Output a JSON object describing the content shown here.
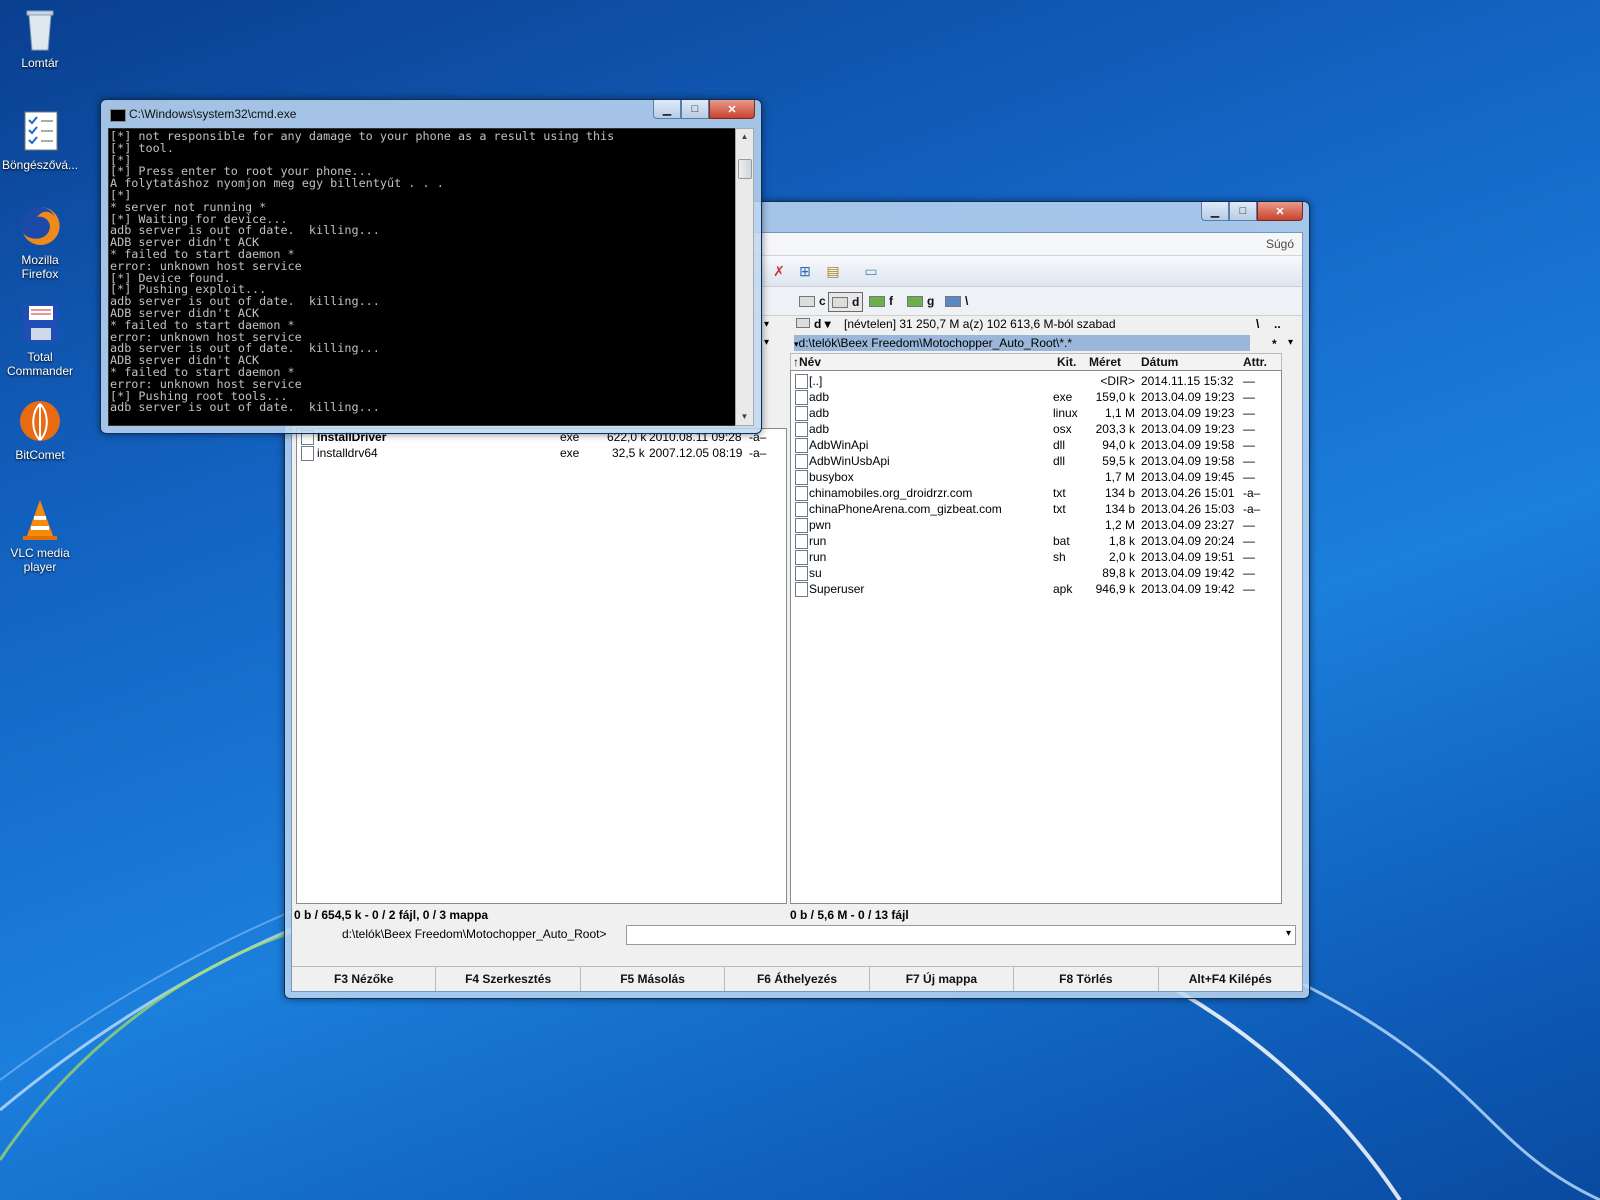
{
  "desktop": {
    "icons": [
      {
        "label": "Lomtár",
        "icon": "recycle-bin-icon"
      },
      {
        "label": "Böngészővá...",
        "icon": "checklist-icon"
      },
      {
        "label": "Mozilla Firefox",
        "icon": "firefox-icon"
      },
      {
        "label": "Total Commander",
        "icon": "floppy-disk-icon"
      },
      {
        "label": "BitComet",
        "icon": "bitcomet-icon"
      },
      {
        "label": "VLC media player",
        "icon": "vlc-cone-icon"
      }
    ]
  },
  "cmd": {
    "title": "C:\\Windows\\system32\\cmd.exe",
    "output": "[*] not responsible for any damage to your phone as a result using this\n[*] tool.\n[*]\n[*] Press enter to root your phone...\nA folytatáshoz nyomjon meg egy billentyűt . . .\n[*]\n* server not running *\n[*] Waiting for device...\nadb server is out of date.  killing...\nADB server didn't ACK\n* failed to start daemon *\nerror: unknown host service\n[*] Device found.\n[*] Pushing exploit...\nadb server is out of date.  killing...\nADB server didn't ACK\n* failed to start daemon *\nerror: unknown host service\nadb server is out of date.  killing...\nADB server didn't ACK\n* failed to start daemon *\nerror: unknown host service\n[*] Pushing root tools...\nadb server is out of date.  killing..."
  },
  "tc": {
    "menu_help": "Súgó",
    "drives": [
      {
        "label": "c",
        "selected": false
      },
      {
        "label": "d",
        "selected": true
      },
      {
        "label": "f",
        "selected": false
      },
      {
        "label": "g",
        "selected": false
      },
      {
        "label": "\\",
        "selected": false
      }
    ],
    "right": {
      "drive_combo": "d",
      "free_space": "[névtelen]  31 250,7 M a(z) 102 613,6 M-ból szabad",
      "root_btn": "\\",
      "up_btn": "..",
      "path": "d:\\telók\\Beex Freedom\\Motochopper_Auto_Root\\*.*",
      "filter": "*",
      "columns": {
        "name": "Név",
        "ext": "Kit.",
        "size": "Méret",
        "date": "Dátum",
        "attr": "Attr."
      },
      "files": [
        {
          "name": "[..]",
          "ext": "",
          "size": "<DIR>",
          "date": "2014.11.15 15:32",
          "attr": "—"
        },
        {
          "name": "adb",
          "ext": "exe",
          "size": "159,0 k",
          "date": "2013.04.09 19:23",
          "attr": "—"
        },
        {
          "name": "adb",
          "ext": "linux",
          "size": "1,1 M",
          "date": "2013.04.09 19:23",
          "attr": "—"
        },
        {
          "name": "adb",
          "ext": "osx",
          "size": "203,3 k",
          "date": "2013.04.09 19:23",
          "attr": "—"
        },
        {
          "name": "AdbWinApi",
          "ext": "dll",
          "size": "94,0 k",
          "date": "2013.04.09 19:58",
          "attr": "—"
        },
        {
          "name": "AdbWinUsbApi",
          "ext": "dll",
          "size": "59,5 k",
          "date": "2013.04.09 19:58",
          "attr": "—"
        },
        {
          "name": "busybox",
          "ext": "",
          "size": "1,7 M",
          "date": "2013.04.09 19:45",
          "attr": "—"
        },
        {
          "name": "chinamobiles.org_droidrzr.com",
          "ext": "txt",
          "size": "134 b",
          "date": "2013.04.26 15:01",
          "attr": "-a–"
        },
        {
          "name": "chinaPhoneArena.com_gizbeat.com",
          "ext": "txt",
          "size": "134 b",
          "date": "2013.04.26 15:03",
          "attr": "-a–"
        },
        {
          "name": "pwn",
          "ext": "",
          "size": "1,2 M",
          "date": "2013.04.09 23:27",
          "attr": "—"
        },
        {
          "name": "run",
          "ext": "bat",
          "size": "1,8 k",
          "date": "2013.04.09 20:24",
          "attr": "—"
        },
        {
          "name": "run",
          "ext": "sh",
          "size": "2,0 k",
          "date": "2013.04.09 19:51",
          "attr": "—"
        },
        {
          "name": "su",
          "ext": "",
          "size": "89,8 k",
          "date": "2013.04.09 19:42",
          "attr": "—"
        },
        {
          "name": "Superuser",
          "ext": "apk",
          "size": "946,9 k",
          "date": "2013.04.09 19:42",
          "attr": "—"
        }
      ],
      "status": "0 b / 5,6 M - 0 / 13 fájl"
    },
    "left": {
      "files": [
        {
          "name": "InstallDriver",
          "ext": "exe",
          "size": "622,0 k",
          "date": "2010.08.11 09:28",
          "attr": "-a–"
        },
        {
          "name": "installdrv64",
          "ext": "exe",
          "size": "32,5 k",
          "date": "2007.12.05 08:19",
          "attr": "-a–"
        }
      ],
      "status": "0 b / 654,5 k - 0 / 2 fájl, 0 / 3 mappa"
    },
    "cmdline_path": "d:\\telók\\Beex Freedom\\Motochopper_Auto_Root>",
    "fkeys": [
      "F3 Nézőke",
      "F4 Szerkesztés",
      "F5 Másolás",
      "F6 Áthelyezés",
      "F7 Új mappa",
      "F8 Törlés",
      "Alt+F4 Kilépés"
    ]
  }
}
